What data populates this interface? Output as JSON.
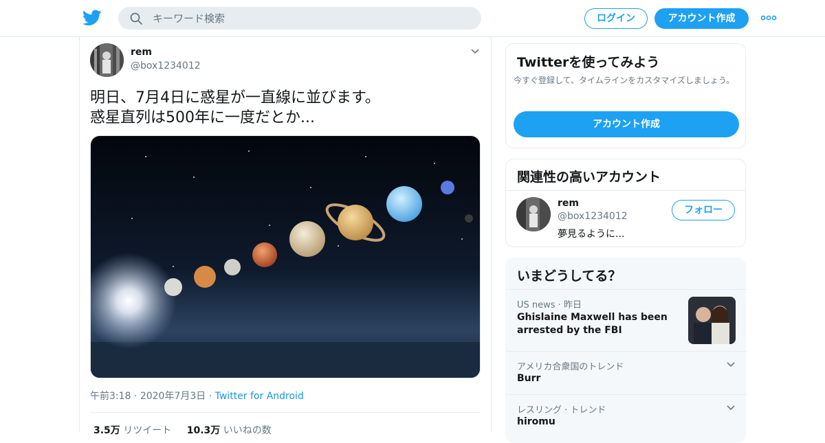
{
  "header": {
    "search_placeholder": "キーワード検索",
    "login_label": "ログイン",
    "signup_label": "アカウント作成"
  },
  "tweet": {
    "name": "rem",
    "handle": "@box1234012",
    "text_line1": "明日、7月4日に惑星が一直線に並びます。",
    "text_line2": "惑星直列は500年に一度だとか...",
    "time": "午前3:18",
    "date": "2020年7月3日",
    "source": "Twitter for Android",
    "sep": "·",
    "retweets": "3.5万",
    "retweets_label": "リツイート",
    "likes": "10.3万",
    "likes_label": "いいねの数"
  },
  "signup_card": {
    "title": "Twitterを使ってみよう",
    "desc": "今すぐ登録して、タイムラインをカスタマイズしましょう。",
    "button": "アカウント作成"
  },
  "related": {
    "title": "関連性の高いアカウント",
    "name": "rem",
    "handle": "@box1234012",
    "bio": "夢見るように...",
    "follow": "フォロー"
  },
  "trends": {
    "title": "いまどうしてる？",
    "items": [
      {
        "context": "US news · 昨日",
        "title": "Ghislaine Maxwell has been arrested by the FBI"
      },
      {
        "context": "アメリカ合衆国のトレンド",
        "title": "Burr"
      },
      {
        "context": "レスリング · トレンド",
        "title": "hiromu"
      }
    ]
  },
  "colors": {
    "accent": "#1da1f2",
    "muted": "#657786",
    "link": "#1b95e0"
  },
  "icons": [
    "twitter-bird-icon",
    "search-icon",
    "more-dots-icon",
    "chevron-down-icon"
  ]
}
